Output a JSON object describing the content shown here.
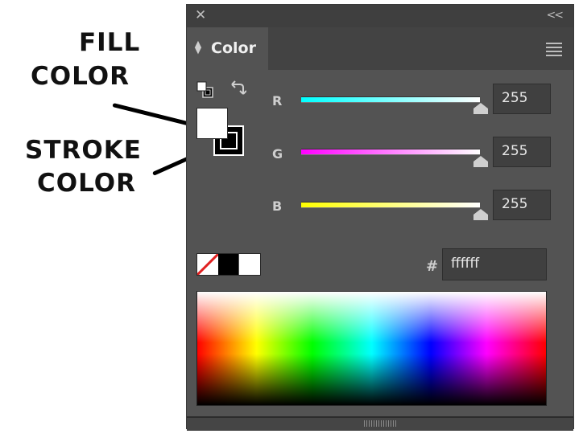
{
  "annotations": {
    "fill_label_line1": "FILL",
    "fill_label_line2": "COLOR",
    "stroke_label_line1": "STROKE",
    "stroke_label_line2": "COLOR"
  },
  "panel": {
    "close_glyph": "✕",
    "collapse_glyph": "<<",
    "tab_label": "Color",
    "tab_icon": "up-down-arrows-icon",
    "menu_icon": "hamburger-menu-icon"
  },
  "swatches": {
    "fill_color": "#ffffff",
    "stroke_color": "#000000",
    "quick": [
      "none",
      "black",
      "white"
    ]
  },
  "channels": [
    {
      "label": "R",
      "value": "255",
      "gradient": [
        "#00ffff",
        "#ffffff"
      ]
    },
    {
      "label": "G",
      "value": "255",
      "gradient": [
        "#ff00ff",
        "#ffffff"
      ]
    },
    {
      "label": "B",
      "value": "255",
      "gradient": [
        "#ffff00",
        "#ffffff"
      ]
    }
  ],
  "hex": {
    "prefix": "#",
    "value": "ffffff"
  }
}
